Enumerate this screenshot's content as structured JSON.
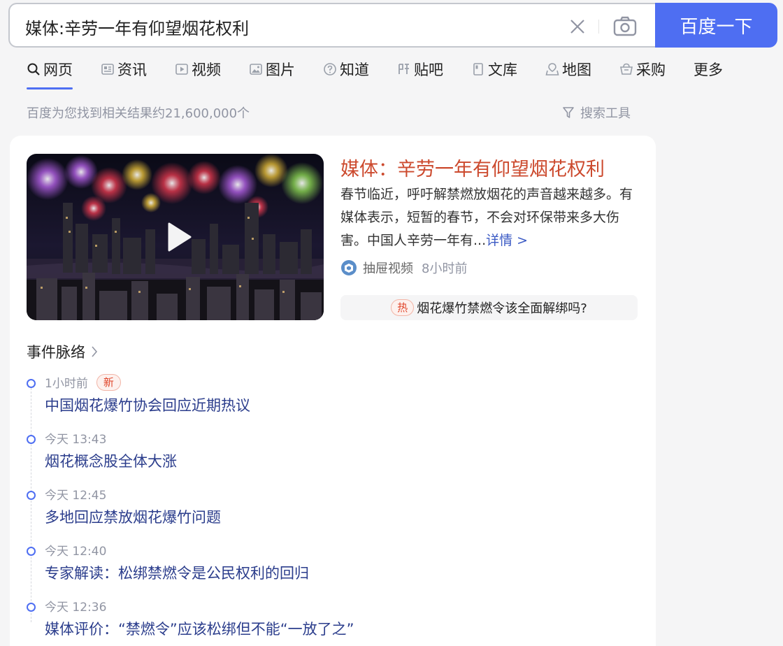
{
  "search": {
    "query": "媒体:辛劳一年有仰望烟花权利",
    "button_label": "百度一下"
  },
  "tabs": [
    {
      "label": "网页",
      "icon": "search-icon"
    },
    {
      "label": "资讯",
      "icon": "news-icon"
    },
    {
      "label": "视频",
      "icon": "video-icon"
    },
    {
      "label": "图片",
      "icon": "image-icon"
    },
    {
      "label": "知道",
      "icon": "question-icon"
    },
    {
      "label": "贴吧",
      "icon": "tieba-icon"
    },
    {
      "label": "文库",
      "icon": "doc-icon"
    },
    {
      "label": "地图",
      "icon": "map-icon"
    },
    {
      "label": "采购",
      "icon": "basket-icon"
    },
    {
      "label": "更多"
    }
  ],
  "results": {
    "count_text": "百度为您找到相关结果约21,600,000个",
    "tools_label": "搜索工具"
  },
  "card": {
    "title": "媒体：辛劳一年有仰望烟花权利",
    "summary": "春节临近，呼吁解禁燃放烟花的声音越来越多。有媒体表示，短暂的春节，不会对环保带来多大伤害。中国人辛劳一年有...",
    "more_label": "详情 >",
    "source_name": "抽屉视频",
    "source_time": "8小时前",
    "hot_tag": "热",
    "hot_text": "烟花爆竹禁燃令该全面解绑吗?"
  },
  "timeline": {
    "title": "事件脉络",
    "new_tag": "新",
    "items": [
      {
        "time": "1小时前",
        "text": "中国烟花爆竹协会回应近期热议"
      },
      {
        "time": "今天 13:43",
        "text": "烟花概念股全体大涨"
      },
      {
        "time": "今天 12:45",
        "text": "多地回应禁放烟花爆竹问题"
      },
      {
        "time": "今天 12:40",
        "text": "专家解读：松绑禁燃令是公民权利的回归"
      },
      {
        "time": "今天 12:36",
        "text": "媒体评价：“禁燃令”应该松绑但不能“一放了之”"
      }
    ]
  },
  "colors": {
    "accent": "#4e6ef2",
    "title_red": "#cc4a2e",
    "link_blue": "#2b3d8c"
  }
}
